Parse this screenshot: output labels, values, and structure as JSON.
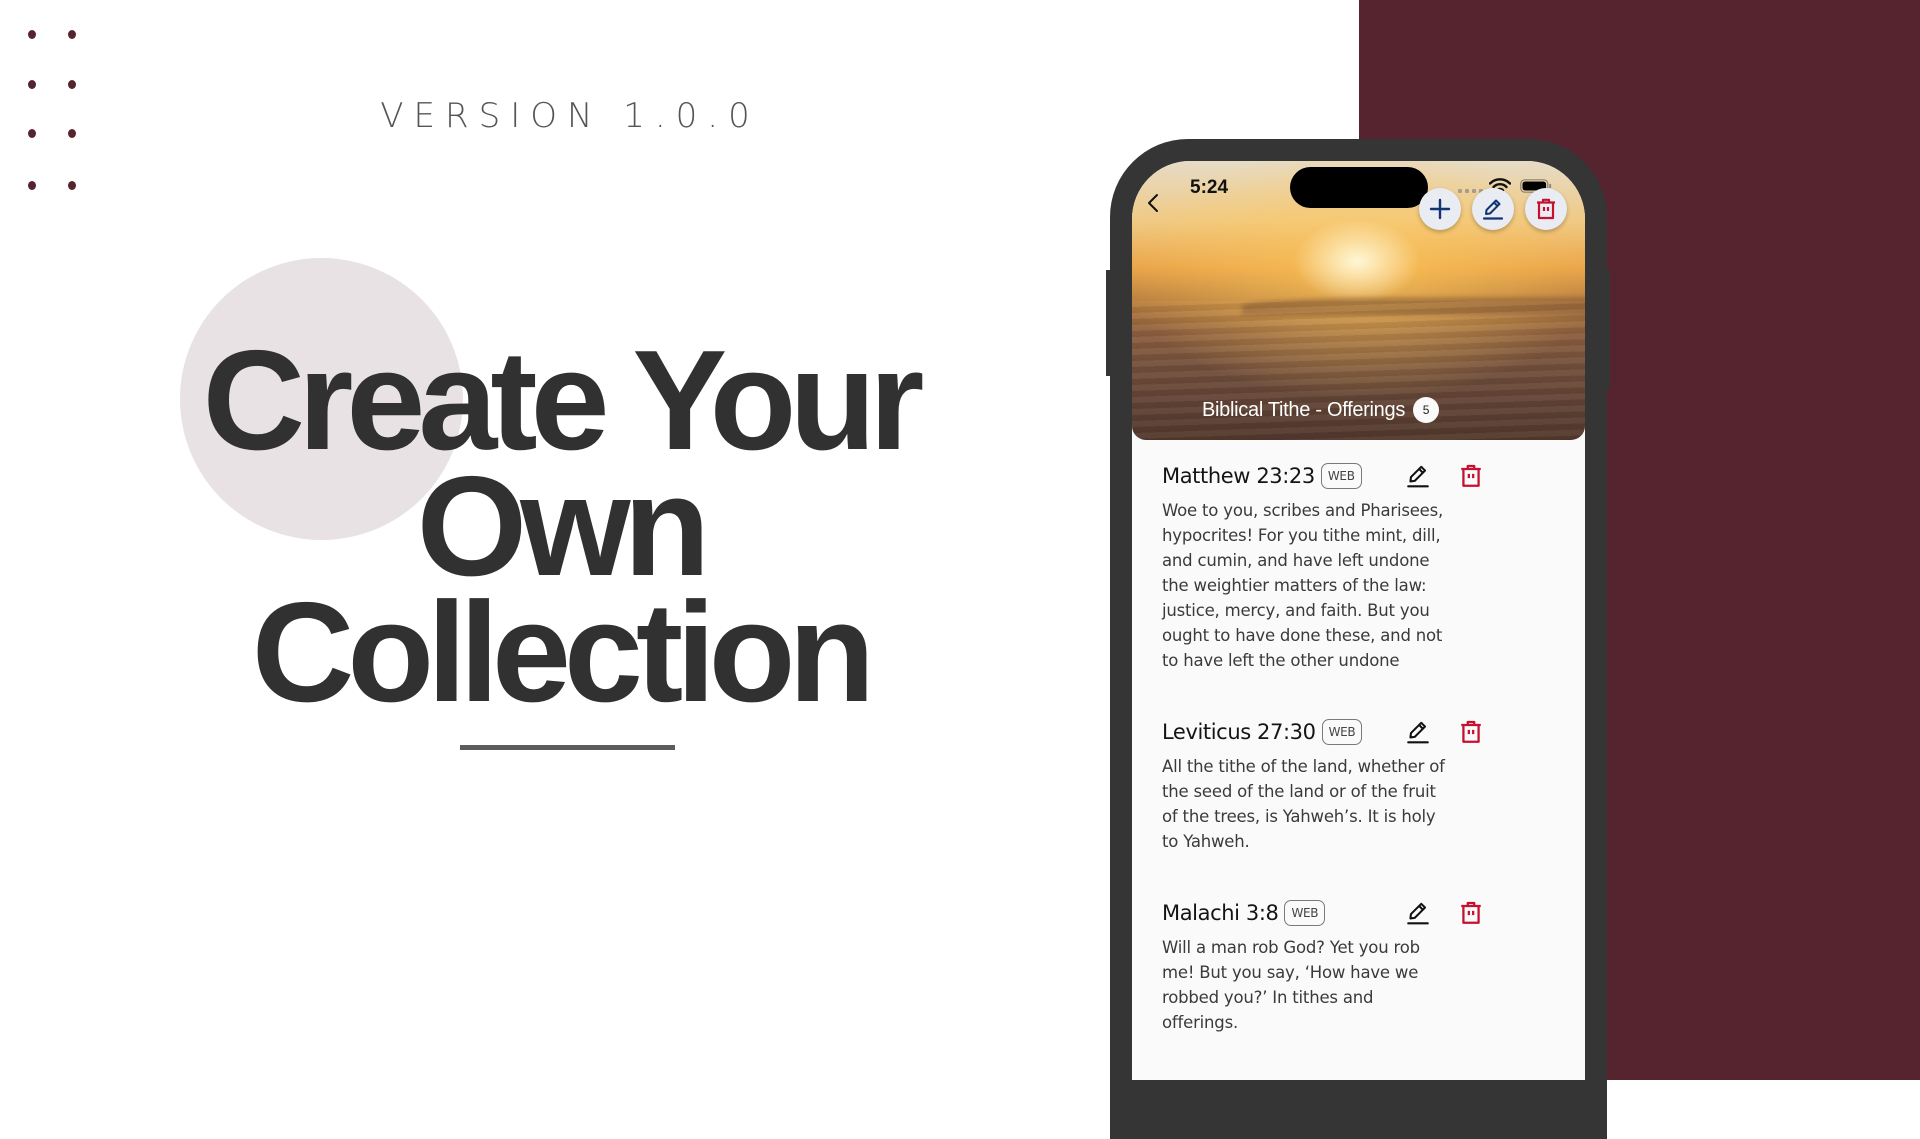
{
  "promo": {
    "version_label": "VERSION 1.0.0",
    "headline_lines": [
      "Create Your",
      "Own",
      "Collection"
    ],
    "colors": {
      "maroon": "#56242f",
      "headline": "#313131",
      "blob": "#e8e2e4"
    }
  },
  "phone": {
    "status_bar": {
      "time": "5:24",
      "icons": [
        "cellular-signal-icon",
        "wifi-icon",
        "battery-icon"
      ]
    },
    "toolbar": {
      "back_icon": "chevron-left-icon",
      "actions": [
        {
          "name": "add",
          "icon": "plus-icon",
          "color": "#123472"
        },
        {
          "name": "edit",
          "icon": "pencil-icon",
          "color": "#123472"
        },
        {
          "name": "delete",
          "icon": "trash-icon",
          "color": "#c4112f"
        }
      ]
    },
    "collection": {
      "title": "Biblical Tithe - Offerings",
      "count": "5"
    },
    "verses": [
      {
        "reference": "Matthew 23:23",
        "translation": "WEB",
        "text": "Woe to you, scribes and Pharisees, hypocrites! For you tithe mint, dill, and cumin, and have left undone the weightier matters of the law: justice, mercy, and faith. But you ought to have done these, and not to have left the other undone"
      },
      {
        "reference": "Leviticus 27:30",
        "translation": "WEB",
        "text": "All the tithe of the land, whether of the seed of the land or of the fruit of the trees, is Yahweh’s. It is holy to Yahweh."
      },
      {
        "reference": "Malachi 3:8",
        "translation": "WEB",
        "text": "Will a man rob God? Yet you rob me! But you say, ‘How have we robbed you?’ In tithes and offerings."
      }
    ]
  }
}
